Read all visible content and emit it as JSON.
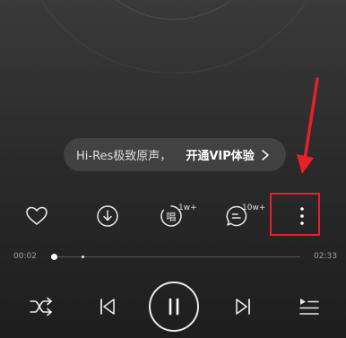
{
  "hires_banner": {
    "prefix": "Hi-Res极致原声，",
    "cta": "开通VIP体验",
    "chevron_icon": "chevron-right-icon"
  },
  "actions": [
    {
      "name": "like",
      "icon": "heart-icon"
    },
    {
      "name": "download",
      "icon": "download-icon"
    },
    {
      "name": "sing",
      "icon": "sing-icon",
      "count": "1w+",
      "glyph": "唱"
    },
    {
      "name": "comment",
      "icon": "comment-icon",
      "count": "10w+"
    },
    {
      "name": "more",
      "icon": "more-vertical-icon",
      "highlighted": true
    }
  ],
  "progress": {
    "current_time": "00:02",
    "total_time": "02:33",
    "played_fraction": 0.014
  },
  "controls": [
    {
      "name": "shuffle",
      "icon": "shuffle-icon"
    },
    {
      "name": "previous",
      "icon": "previous-track-icon"
    },
    {
      "name": "pause",
      "icon": "pause-icon"
    },
    {
      "name": "next",
      "icon": "next-track-icon"
    },
    {
      "name": "playlist",
      "icon": "playlist-icon"
    }
  ],
  "colors": {
    "highlight_box": "#e8202a",
    "annotation_arrow": "#e8202a"
  }
}
